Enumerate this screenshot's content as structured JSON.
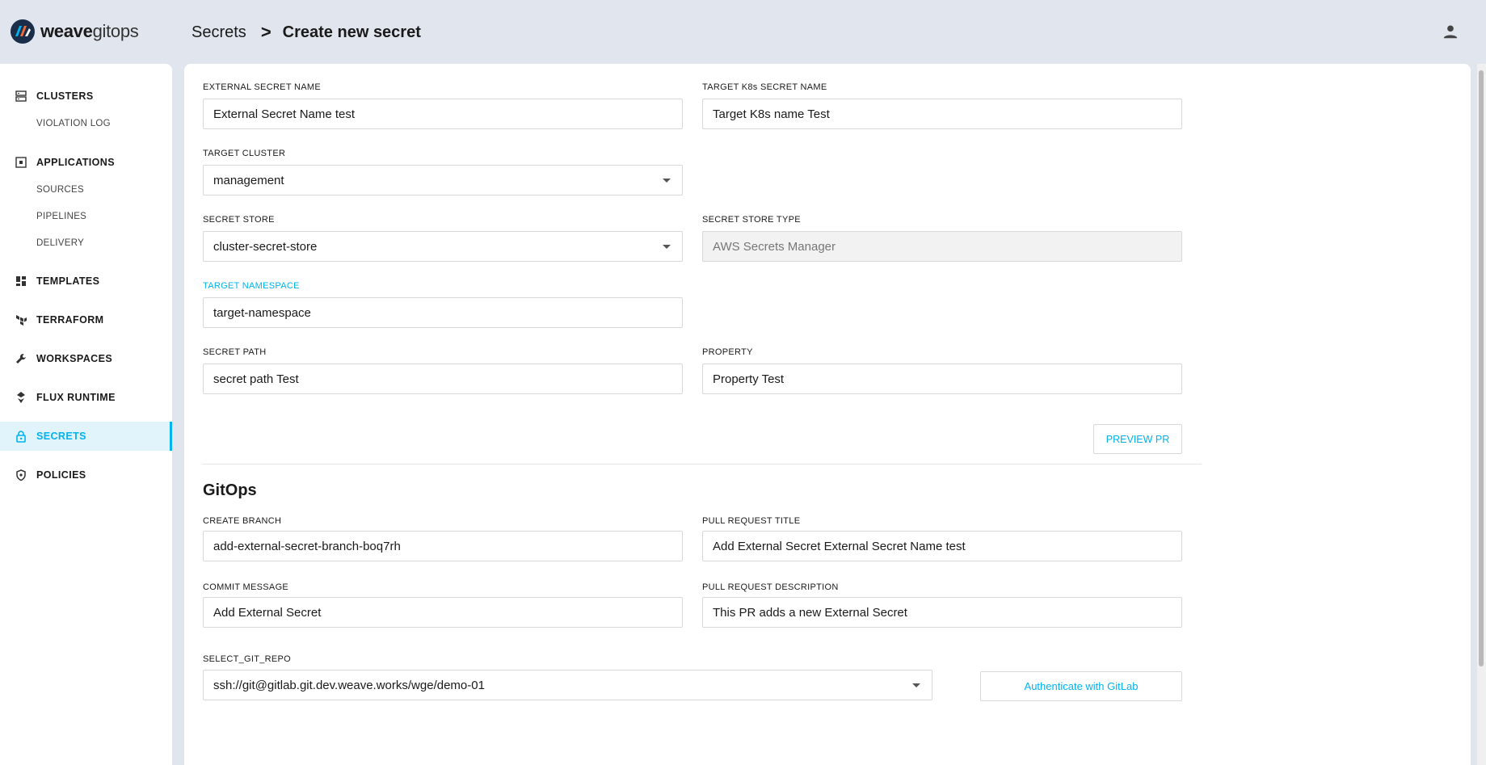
{
  "app": {
    "brand_bold": "weave",
    "brand_light": "gitops"
  },
  "breadcrumb": {
    "parent": "Secrets",
    "separator": ">",
    "current": "Create new secret"
  },
  "sidebar": {
    "clusters": "CLUSTERS",
    "violation_log": "VIOLATION LOG",
    "applications": "APPLICATIONS",
    "sources": "SOURCES",
    "pipelines": "PIPELINES",
    "delivery": "DELIVERY",
    "templates": "TEMPLATES",
    "terraform": "TERRAFORM",
    "workspaces": "WORKSPACES",
    "flux_runtime": "FLUX RUNTIME",
    "secrets": "SECRETS",
    "policies": "POLICIES"
  },
  "form": {
    "external_secret_name": {
      "label": "EXTERNAL SECRET NAME",
      "value": "External Secret Name test"
    },
    "target_k8s_secret_name": {
      "label": "TARGET K8s SECRET NAME",
      "value": "Target K8s name Test"
    },
    "target_cluster": {
      "label": "TARGET CLUSTER",
      "value": "management"
    },
    "secret_store": {
      "label": "SECRET STORE",
      "value": "cluster-secret-store"
    },
    "secret_store_type": {
      "label": "SECRET STORE TYPE",
      "value": "AWS Secrets Manager"
    },
    "target_namespace": {
      "label": "TARGET NAMESPACE",
      "value": "target-namespace"
    },
    "secret_path": {
      "label": "SECRET PATH",
      "value": "secret path Test"
    },
    "property": {
      "label": "PROPERTY",
      "value": "Property Test"
    },
    "preview_pr": "PREVIEW PR"
  },
  "gitops": {
    "title": "GitOps",
    "create_branch": {
      "label": "CREATE BRANCH",
      "value": "add-external-secret-branch-boq7rh"
    },
    "pull_request_title": {
      "label": "PULL REQUEST TITLE",
      "value": "Add External Secret External Secret Name test"
    },
    "commit_message": {
      "label": "COMMIT MESSAGE",
      "value": "Add External Secret"
    },
    "pull_request_description": {
      "label": "PULL REQUEST DESCRIPTION",
      "value": "This PR adds a new External Secret"
    },
    "select_git_repo": {
      "label": "SELECT_GIT_REPO",
      "value": "ssh://git@gitlab.git.dev.weave.works/wge/demo-01"
    },
    "authenticate": "Authenticate with GitLab"
  },
  "colors": {
    "accent": "#00b3ec",
    "background": "#e1e5ee",
    "card": "#ffffff"
  }
}
